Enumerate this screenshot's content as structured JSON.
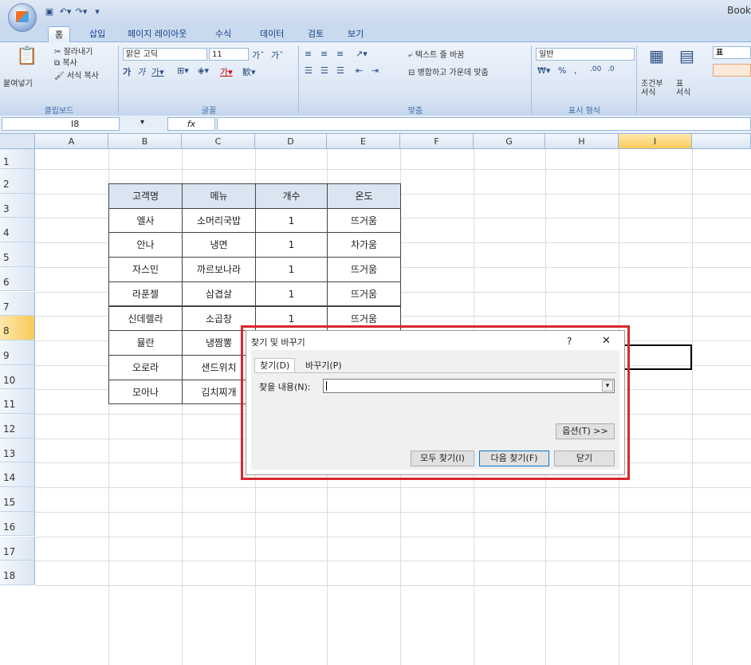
{
  "window": {
    "title": "Book"
  },
  "ribbon_tabs": [
    "홈",
    "삽입",
    "페이지 레이아웃",
    "수식",
    "데이터",
    "검토",
    "보기"
  ],
  "clipboard": {
    "paste": "붙여넣기",
    "cut": "잘라내기",
    "copy": "복사",
    "format_painter": "서식 복사",
    "group_label": "클립보드"
  },
  "font": {
    "name": "맑은 고딕",
    "size": "11",
    "group_label": "글꼴"
  },
  "alignment": {
    "wrap_text": "텍스트 줄 바꿈",
    "merge_center": "병합하고 가운데 맞춤",
    "group_label": "맞춤"
  },
  "number": {
    "format": "일반",
    "group_label": "표시 형식"
  },
  "styles": {
    "conditional": "조건부\n서식",
    "table": "표\n서식",
    "style_label": "표"
  },
  "formula_bar": {
    "name_box": "I8",
    "fx": "fx"
  },
  "columns": [
    "A",
    "B",
    "C",
    "D",
    "E",
    "F",
    "G",
    "H",
    "I"
  ],
  "rows": [
    "1",
    "2",
    "3",
    "4",
    "5",
    "6",
    "7",
    "8",
    "9",
    "10",
    "11",
    "12",
    "13",
    "14",
    "15",
    "16",
    "17",
    "18"
  ],
  "table": {
    "headers": [
      "고객명",
      "메뉴",
      "개수",
      "온도"
    ],
    "rows": [
      [
        "엘사",
        "소머리국밥",
        "1",
        "뜨거움"
      ],
      [
        "안나",
        "냉면",
        "1",
        "차가움"
      ],
      [
        "자스민",
        "까르보나라",
        "1",
        "뜨거움"
      ],
      [
        "라푼젤",
        "삼겹살",
        "1",
        "뜨거움"
      ],
      [
        "신데렐라",
        "소곱창",
        "1",
        "뜨거움"
      ],
      [
        "뮬란",
        "냉짬뽕",
        "",
        ""
      ],
      [
        "오로라",
        "샌드위치",
        "",
        ""
      ],
      [
        "모아나",
        "김치찌개",
        "",
        ""
      ]
    ]
  },
  "dialog": {
    "title": "찾기 및 바꾸기",
    "help": "?",
    "close": "✕",
    "tab_find": "찾기(D)",
    "tab_replace": "바꾸기(P)",
    "find_label": "찾을 내용(N):",
    "find_value": "",
    "options": "옵션(T) >>",
    "find_all": "모두 찾기(I)",
    "find_next": "다음 찾기(F)",
    "close_button": "닫기"
  }
}
